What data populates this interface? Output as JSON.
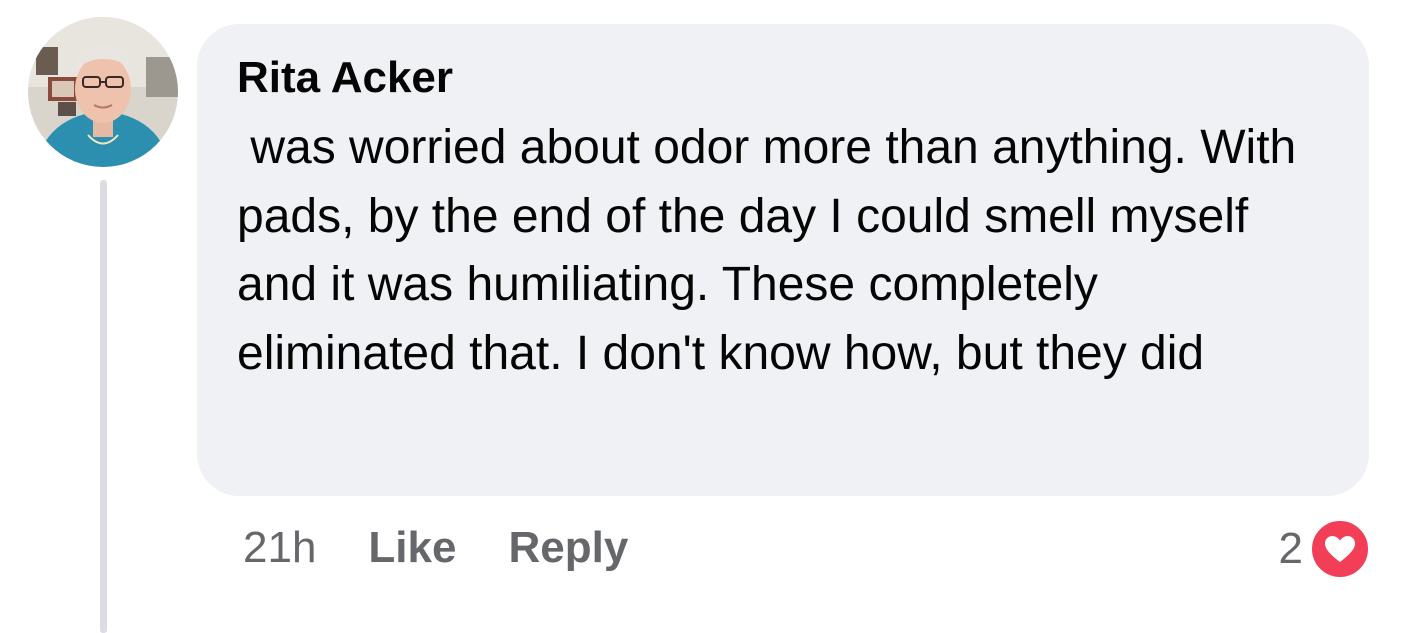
{
  "comment": {
    "author": "Rita Acker",
    "text": " was worried about odor more than anything. With pads, by the end of the day I could smell myself and it was humiliating. These completely eliminated that. I don't know how, but they did",
    "time": "21h",
    "like_label": "Like",
    "reply_label": "Reply",
    "reaction_count": "2",
    "reaction_type": "love-heart-icon"
  },
  "colors": {
    "bubble": "#f0f1f5",
    "meta_text": "#65676b",
    "heart": "#f33e58",
    "thread_line": "#dcdde1"
  }
}
